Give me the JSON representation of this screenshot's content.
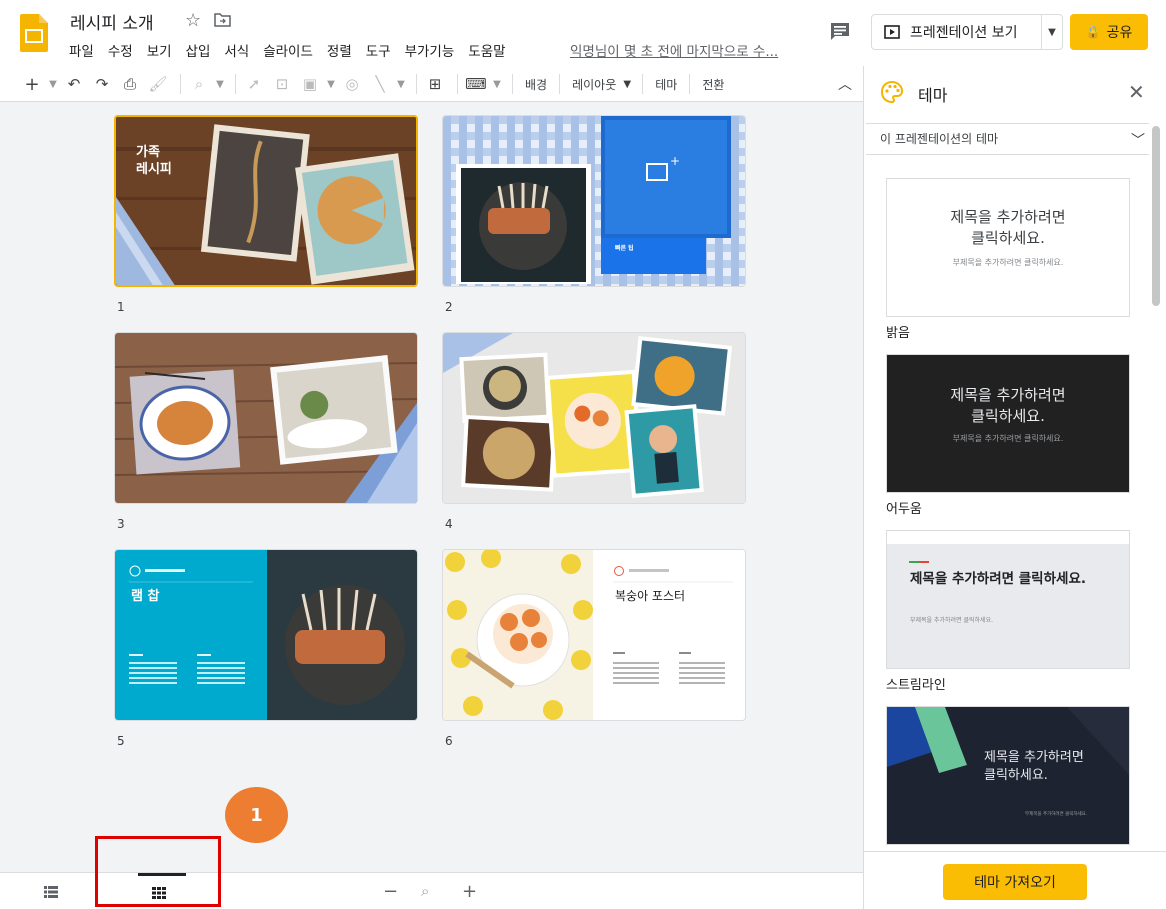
{
  "app": {
    "doc_title": "레시피 소개",
    "last_edit": "익명님이 몇 초 전에 마지막으로 수..."
  },
  "menu": [
    "파일",
    "수정",
    "보기",
    "삽입",
    "서식",
    "슬라이드",
    "정렬",
    "도구",
    "부가기능",
    "도움말"
  ],
  "header": {
    "present_label": "프레젠테이션 보기",
    "share_label": "공유"
  },
  "toolbar": {
    "background_label": "배경",
    "layout_label": "레이아웃",
    "theme_label": "테마",
    "transition_label": "전환"
  },
  "slides": [
    {
      "number": "1",
      "title": "가족 레시피",
      "title_line1": "가족",
      "title_line2": "레시피",
      "selected": true
    },
    {
      "number": "2",
      "caption": "빠른 팁"
    },
    {
      "number": "3"
    },
    {
      "number": "4"
    },
    {
      "number": "5",
      "title": "램 찹"
    },
    {
      "number": "6",
      "title": "복숭아 포스터"
    }
  ],
  "panel": {
    "title": "테마",
    "section_label": "이 프레젠테이션의 테마",
    "placeholder_title_line1": "제목을 추가하려면",
    "placeholder_title_line2": "클릭하세요.",
    "placeholder_title_oneline": "제목을 추가하려면 클릭하세요.",
    "placeholder_subtitle": "부제목을 추가하려면 클릭하세요.",
    "themes": [
      {
        "name": "밝음",
        "bg": "#ffffff"
      },
      {
        "name": "어두움",
        "bg": "#212121"
      },
      {
        "name": "스트림라인",
        "bg": "#e8eaed"
      },
      {
        "name": "",
        "bg": "#1e2331"
      }
    ],
    "import_label": "테마 가져오기"
  },
  "annotation": {
    "step_number": "1"
  },
  "colors": {
    "accent": "#fbbc04",
    "selected_border": "#f4b400",
    "annotation_badge": "#ed7d31",
    "highlight": "#e00000"
  }
}
